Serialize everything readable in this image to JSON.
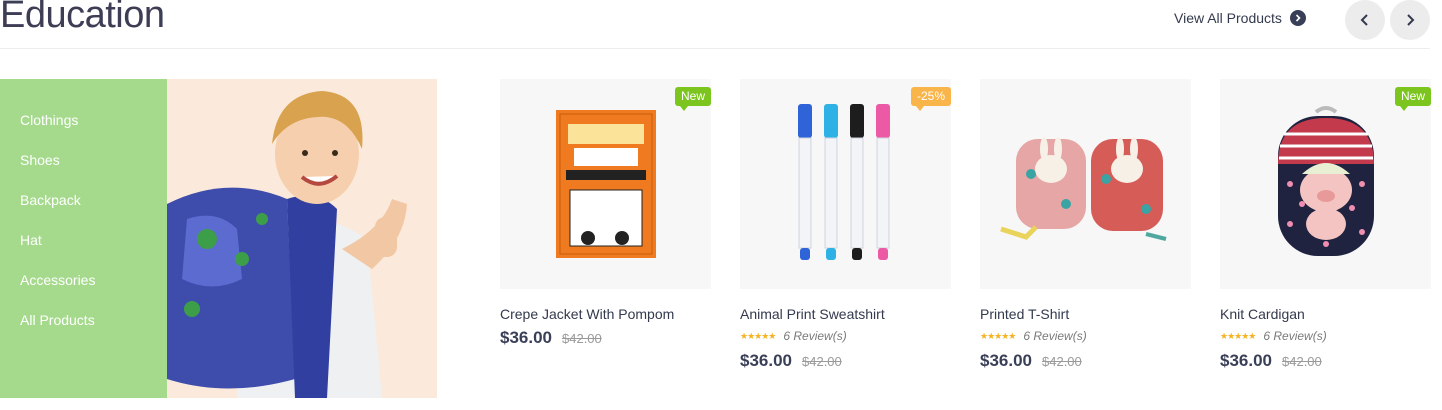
{
  "section": {
    "title": "Education",
    "view_all_label": "View All Products"
  },
  "colors": {
    "accent_green": "#a5da8d",
    "badge_new": "#7cc51f",
    "badge_sale": "#f9b44a",
    "star": "#f5b323",
    "price": "#3a3f58"
  },
  "sidebar": {
    "items": [
      {
        "label": "Clothings"
      },
      {
        "label": "Shoes"
      },
      {
        "label": "Backpack"
      },
      {
        "label": "Hat"
      },
      {
        "label": "Accessories"
      },
      {
        "label": "All Products"
      }
    ]
  },
  "products": [
    {
      "name": "Crepe Jacket With Pompom",
      "price": "$36.00",
      "old_price": "$42.00",
      "badge": "New",
      "reviews": "",
      "image": "book-icon"
    },
    {
      "name": "Animal Print Sweatshirt",
      "price": "$36.00",
      "old_price": "$42.00",
      "badge": "-25%",
      "reviews": "6 Review(s)",
      "image": "markers-icon"
    },
    {
      "name": "Printed T-Shirt",
      "price": "$36.00",
      "old_price": "$42.00",
      "badge": "",
      "reviews": "6 Review(s)",
      "image": "backpacks-icon"
    },
    {
      "name": "Knit Cardigan",
      "price": "$36.00",
      "old_price": "$42.00",
      "badge": "New",
      "reviews": "6 Review(s)",
      "image": "backpack-icon"
    }
  ]
}
